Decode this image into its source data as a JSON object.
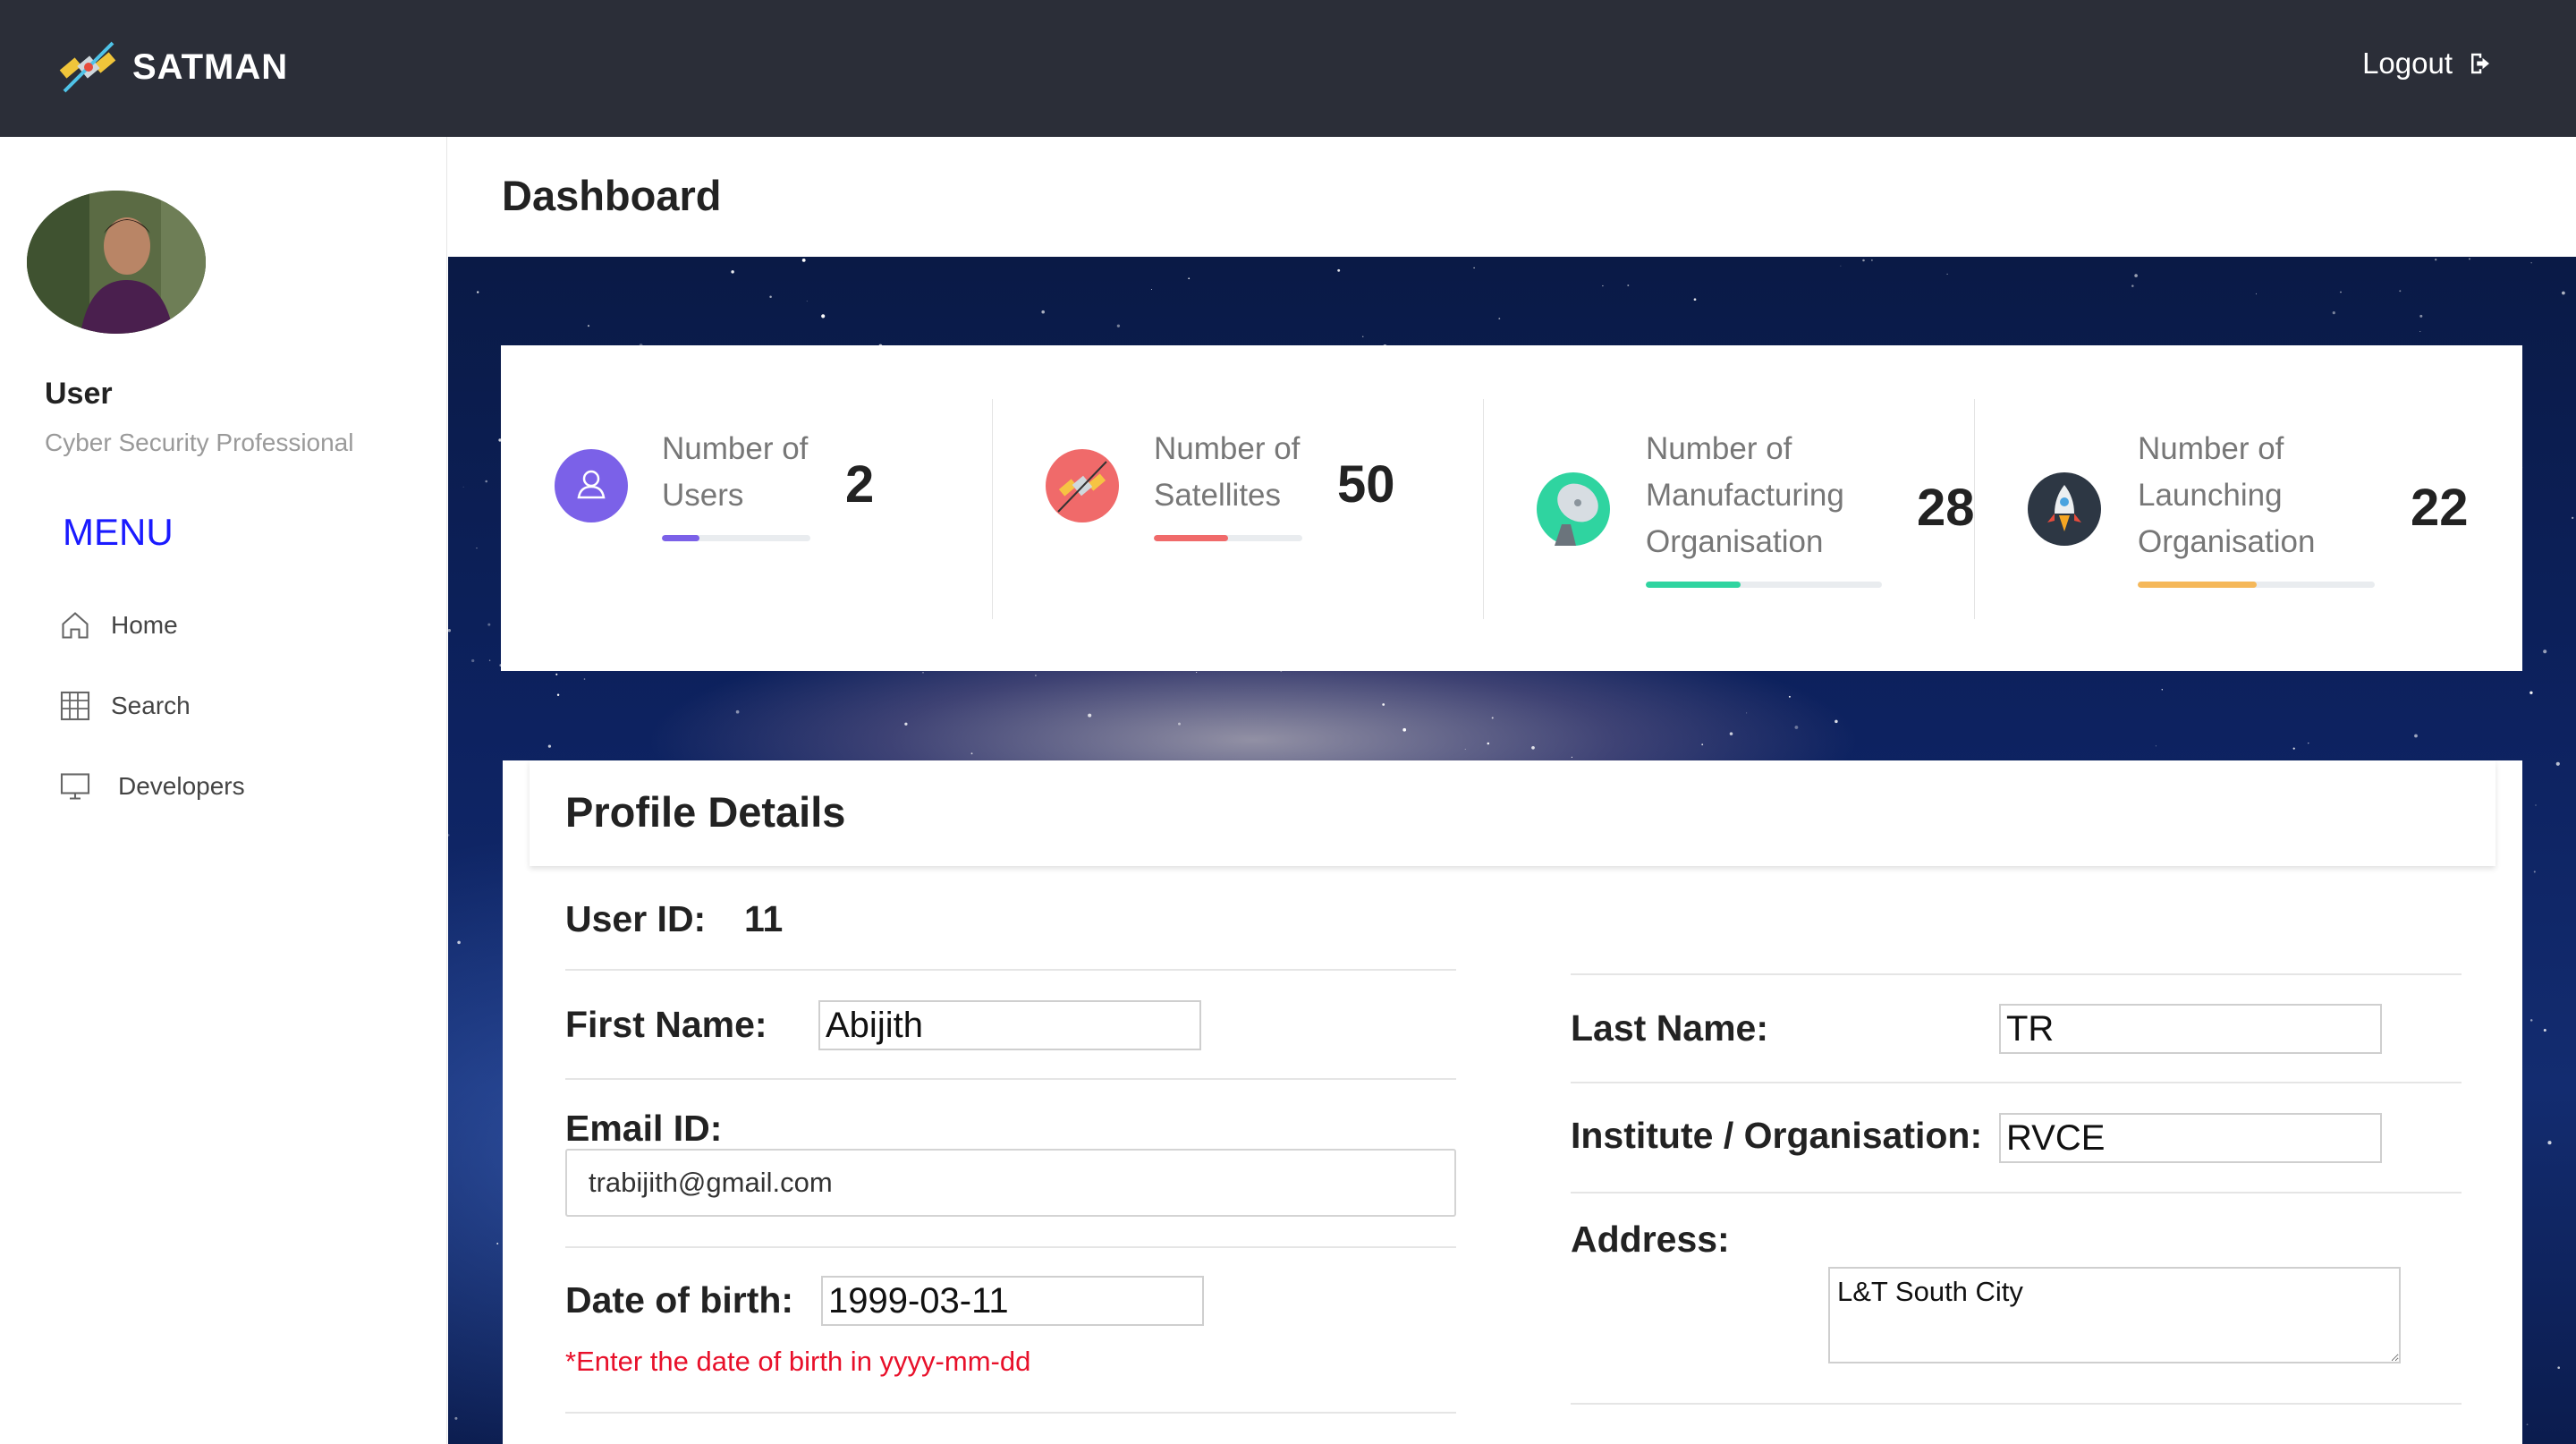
{
  "app": {
    "brand": "SATMAN",
    "logout_label": "Logout"
  },
  "sidebar": {
    "user_name": "User",
    "user_role": "Cyber Security Professional",
    "menu_title": "MENU",
    "items": [
      {
        "label": "Home",
        "icon": "home-icon"
      },
      {
        "label": "Search",
        "icon": "grid-icon"
      },
      {
        "label": "Developers",
        "icon": "monitor-icon"
      }
    ]
  },
  "page": {
    "title": "Dashboard"
  },
  "stats": [
    {
      "label_lines": [
        "Number of",
        "Users"
      ],
      "value": "2",
      "progress_pct": 25,
      "icon": "user-icon",
      "color": "#7b61e8"
    },
    {
      "label_lines": [
        "Number of",
        "Satellites"
      ],
      "value": "50",
      "progress_pct": 50,
      "icon": "satellite-icon",
      "color": "#f06a6a"
    },
    {
      "label_lines": [
        "Number of",
        "Manufacturing",
        "Organisation"
      ],
      "value": "28",
      "progress_pct": 40,
      "icon": "satellite-dish-icon",
      "color": "#2fd4a0"
    },
    {
      "label_lines": [
        "Number of",
        "Launching",
        "Organisation"
      ],
      "value": "22",
      "progress_pct": 50,
      "icon": "rocket-icon",
      "color": "#f5b85a"
    }
  ],
  "profile": {
    "title": "Profile Details",
    "user_id_label": "User ID:",
    "user_id": "11",
    "first_name_label": "First Name:",
    "first_name": "Abijith",
    "last_name_label": "Last Name:",
    "last_name": "TR",
    "email_label": "Email ID:",
    "email": "trabijith@gmail.com",
    "institute_label": "Institute / Organisation:",
    "institute": "RVCE",
    "dob_label": "Date of birth:",
    "dob": "1999-03-11",
    "dob_hint": "*Enter the date of birth in yyyy-mm-dd",
    "address_label": "Address:",
    "address": "L&T South City"
  }
}
